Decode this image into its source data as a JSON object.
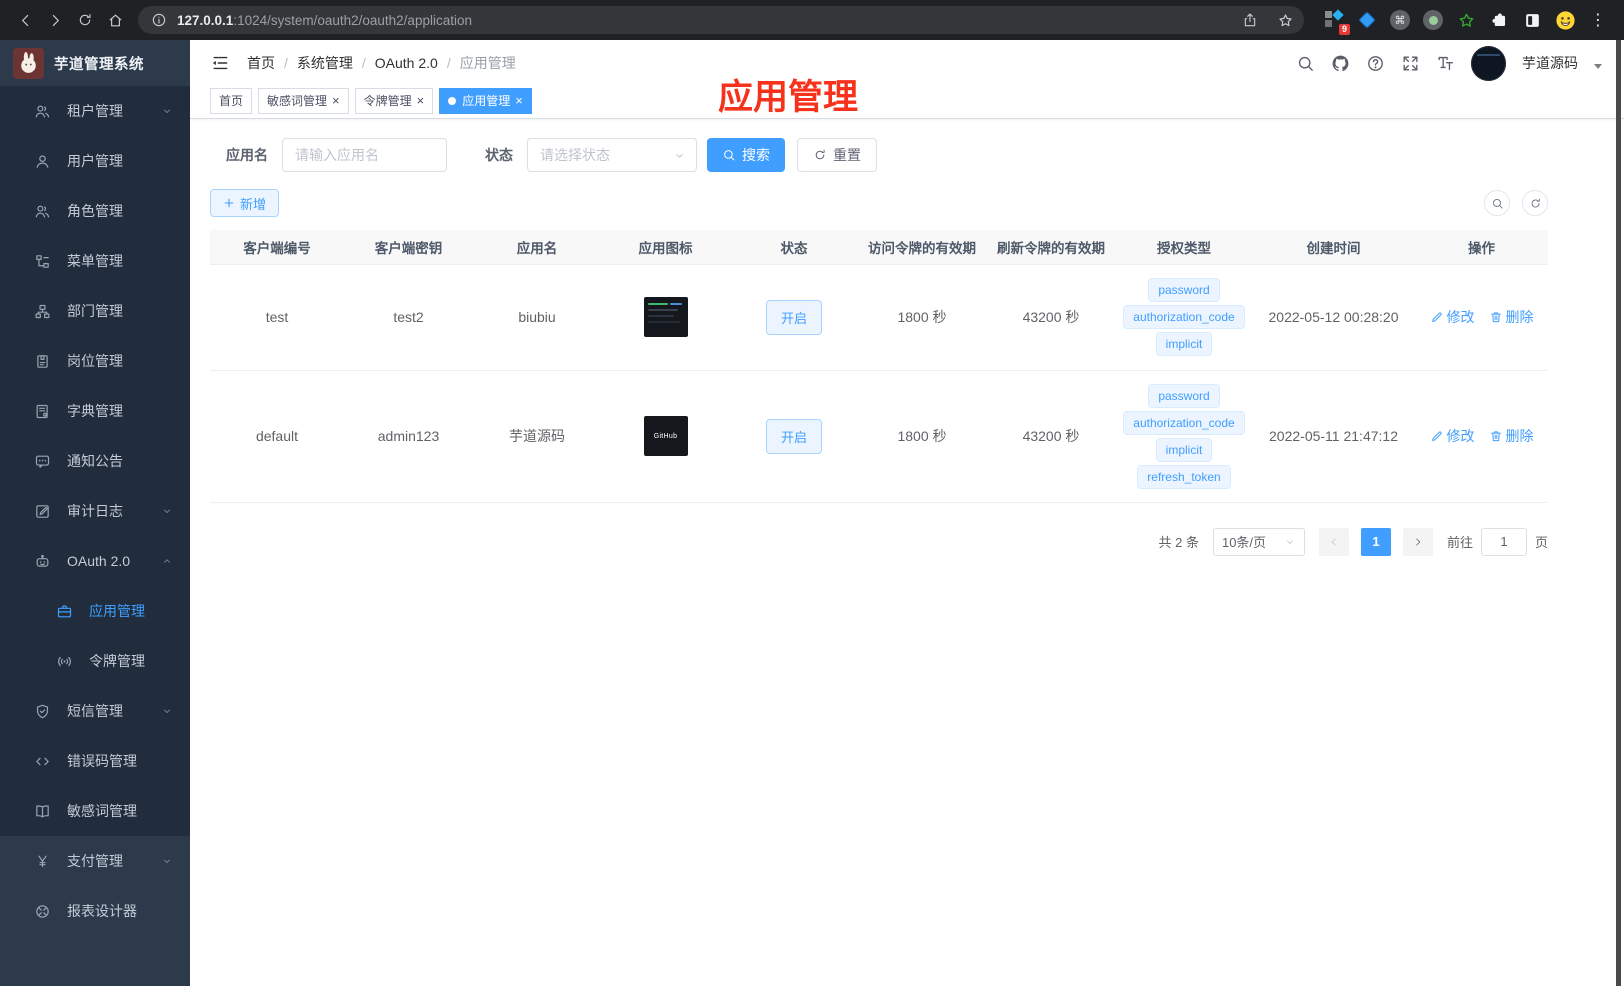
{
  "glyphs": {
    "close": "×",
    "menu_dots": "⋮",
    "cmd": "⌘"
  },
  "browser": {
    "url_host": "127.0.0.1",
    "url_rest": ":1024/system/oauth2/oauth2/application",
    "ext_badge": "9"
  },
  "sidebar": {
    "logo_title": "芋道管理系统",
    "items": [
      {
        "label": "租户管理",
        "icon": "users-icon",
        "chevron": "down"
      },
      {
        "label": "用户管理",
        "icon": "user-icon"
      },
      {
        "label": "角色管理",
        "icon": "users-icon"
      },
      {
        "label": "菜单管理",
        "icon": "menu-tree-icon"
      },
      {
        "label": "部门管理",
        "icon": "org-chart-icon"
      },
      {
        "label": "岗位管理",
        "icon": "badge-icon"
      },
      {
        "label": "字典管理",
        "icon": "dictionary-icon"
      },
      {
        "label": "通知公告",
        "icon": "announcement-icon"
      },
      {
        "label": "审计日志",
        "icon": "audit-log-icon",
        "chevron": "down"
      },
      {
        "label": "OAuth 2.0",
        "icon": "robot-icon",
        "chevron": "up"
      },
      {
        "label": "应用管理",
        "icon": "briefcase-icon",
        "sub": true,
        "active": true
      },
      {
        "label": "令牌管理",
        "icon": "broadcast-icon",
        "sub": true
      },
      {
        "label": "短信管理",
        "icon": "shield-check-icon",
        "chevron": "down"
      },
      {
        "label": "错误码管理",
        "icon": "code-icon"
      },
      {
        "label": "敏感词管理",
        "icon": "open-book-icon"
      }
    ],
    "bottom_items": [
      {
        "label": "支付管理",
        "icon": "yen-icon",
        "chevron": "down"
      },
      {
        "label": "报表设计器",
        "icon": "report-designer-icon"
      }
    ]
  },
  "header": {
    "breadcrumb": [
      "首页",
      "系统管理",
      "OAuth 2.0",
      "应用管理"
    ],
    "separator": "/",
    "username": "芋道源码"
  },
  "tabs": [
    {
      "label": "首页"
    },
    {
      "label": "敏感词管理",
      "closable": true
    },
    {
      "label": "令牌管理",
      "closable": true
    },
    {
      "label": "应用管理",
      "closable": true,
      "active": true
    }
  ],
  "annotation": {
    "text": "应用管理",
    "color": "#f7321c"
  },
  "filters": {
    "name_label": "应用名",
    "name_placeholder": "请输入应用名",
    "status_label": "状态",
    "status_placeholder": "请选择状态",
    "search_label": "搜索",
    "reset_label": "重置"
  },
  "toolbar": {
    "add_label": "新增"
  },
  "table": {
    "headers": [
      "客户端编号",
      "客户端密钥",
      "应用名",
      "应用图标",
      "状态",
      "访问令牌的有效期",
      "刷新令牌的有效期",
      "授权类型",
      "创建时间",
      "操作"
    ],
    "rows": [
      {
        "client_id": "test",
        "client_secret": "test2",
        "app_name": "biubiu",
        "status": "开启",
        "access_token_ttl": "1800 秒",
        "refresh_token_ttl": "43200 秒",
        "grant_types": [
          "password",
          "authorization_code",
          "implicit"
        ],
        "created_at": "2022-05-12 00:28:20",
        "icon_label": ""
      },
      {
        "client_id": "default",
        "client_secret": "admin123",
        "app_name": "芋道源码",
        "status": "开启",
        "access_token_ttl": "1800 秒",
        "refresh_token_ttl": "43200 秒",
        "grant_types": [
          "password",
          "authorization_code",
          "implicit",
          "refresh_token"
        ],
        "created_at": "2022-05-11 21:47:12",
        "icon_label": "GitHub"
      }
    ],
    "edit_label": "修改",
    "delete_label": "删除"
  },
  "pagination": {
    "total": "共 2 条",
    "page_size": "10条/页",
    "current_page": "1",
    "goto_label": "前往",
    "goto_value": "1",
    "unit_label": "页"
  },
  "colors": {
    "primary": "#409eff",
    "annotation_red": "#f7321c"
  }
}
